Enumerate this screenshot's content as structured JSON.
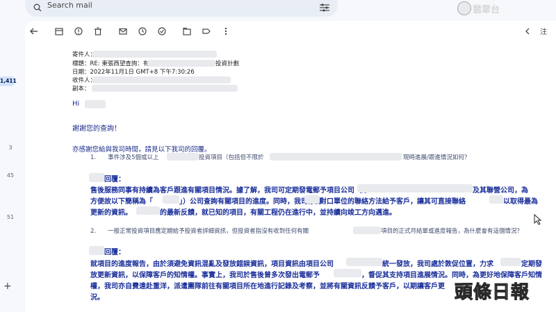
{
  "search": {
    "placeholder": "Search mail"
  },
  "watermark_top": "翡翠台",
  "toolbar": {
    "right_label": "注"
  },
  "rail": {
    "badge": "1,411",
    "counts": [
      "3",
      "45",
      "51"
    ]
  },
  "email": {
    "sender_label": "寄件人：",
    "subject_label": "標題：RE: 東張西望查詢：有關",
    "subject_suffix": "投資計劃",
    "date_label": "日期：2022年11月1日 GMT+8 下午7:30:26",
    "to_label": "收件人：",
    "cc_label": "副本：",
    "greeting": "Hi",
    "thanks": "謝謝您的查詢！",
    "intro": "亦感謝您給與我司時間，請見以下我司的回覆。",
    "q1_prefix": "1.　　事件涉及5個或以上",
    "q1_mid": "投資項目（包括但不限於",
    "q1_suffix": "現時進展/跟進情況如何？",
    "reply_label": "回覆：",
    "a1_line1_a": "售後服務同事有持續為客戶跟進有關項目情況。據了解，我司可定期發電郵予項目公司（即",
    "a1_line1_b": "及其聯營公司，為",
    "a1_line2_a": "方便故以下簡稱為「",
    "a1_line2_b": "」）公司查詢有關項目的進度。同時，我司亦將",
    "a1_line2_c": "對口單位的聯絡方法給予客戶，讓其可直接聯絡",
    "a1_line2_d": "以取得最為",
    "a1_line3": "更新的資訊。",
    "a1_line3_b": "的最新反饋，就已知的項目，有關工程仍在進行中，並持續向竣工方向邁進。",
    "q2_prefix": "2.　　一般正常投資項目應定期給予投資者詳細資訊，但投資者指沒有收到任何有關",
    "q2_suffix": "項目的正式月結單或進度報告，為什麼會有這個情況？",
    "a2_line1_a": "就項目的進度報告，由於須避免資訊混亂及發放錯誤資訊，項目資訊由項目公司",
    "a2_line1_b": "統一發放，我司處於敦促位置，力求",
    "a2_line1_c": "定期發",
    "a2_line2_a": "放更新資訊，以保障客戶的知情權。事實上，我司於售後曾多次發出電郵予",
    "a2_line2_b": "，督促其支持項目進展情況。同時，為更好地保障客戶知情",
    "a2_line3_a": "權，我司亦自費遠赴重洋，派遣團隊前往有關項目所在地進行記錄及考察，並將有關資訊反饋予客戶，以期讓客戶更",
    "a2_line4": "況。"
  },
  "watermark_bottom": "頭條日報"
}
